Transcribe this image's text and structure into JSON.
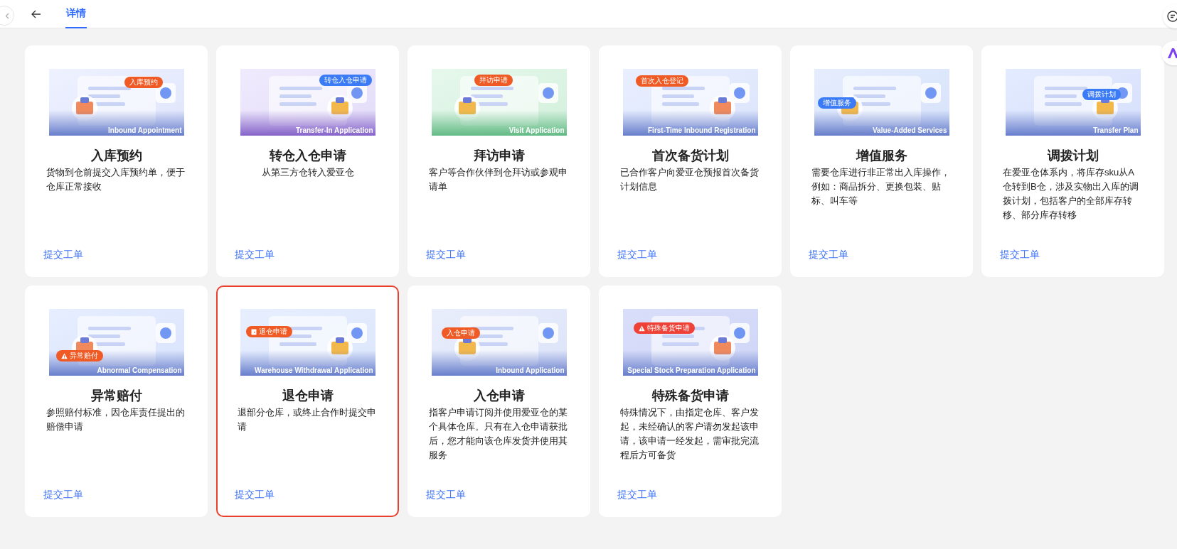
{
  "header": {
    "tabs": [
      {
        "label": "详情",
        "selected": true
      }
    ]
  },
  "cards": [
    {
      "title": "入库预约",
      "description": "货物到仓前提交入库预约单，便于仓库正常接收",
      "link": "提交工单",
      "selected": false,
      "image": {
        "badge": {
          "label": "入库预约",
          "color": "#f05a24",
          "kind": "plain"
        },
        "caption": "Inbound Appointment"
      }
    },
    {
      "title": "转仓入仓申请",
      "description": "从第三方仓转入爱亚仓",
      "link": "提交工单",
      "selected": false,
      "image": {
        "badge": {
          "label": "转仓入仓申请",
          "color": "#3b7cf6",
          "kind": "plain"
        },
        "caption": "Transfer-In Application"
      }
    },
    {
      "title": "拜访申请",
      "description": "客户等合作伙伴到仓拜访或参观申请单",
      "link": "提交工单",
      "selected": false,
      "image": {
        "badge": {
          "label": "拜访申请",
          "color": "#f05a24",
          "kind": "plain"
        },
        "caption": "Visit Application"
      }
    },
    {
      "title": "首次备货计划",
      "description": "已合作客户向爱亚仓预报首次备货计划信息",
      "link": "提交工单",
      "selected": false,
      "image": {
        "badge": {
          "label": "首次入仓登记",
          "color": "#f05a24",
          "kind": "plain"
        },
        "caption": "First-Time Inbound Registration"
      }
    },
    {
      "title": "增值服务",
      "description": "需要仓库进行非正常出入库操作，例如：商品拆分、更换包装、贴标、叫车等",
      "link": "提交工单",
      "selected": false,
      "image": {
        "badge": {
          "label": "增值服务",
          "color": "#3b7cf6",
          "kind": "plain"
        },
        "caption": "Value-Added Services"
      }
    },
    {
      "title": "调拨计划",
      "description": "在爱亚仓体系内，将库存sku从A仓转到B仓，涉及实物出入库的调拨计划，包括客户的全部库存转移、部分库存转移",
      "link": "提交工单",
      "selected": false,
      "image": {
        "badge": {
          "label": "调拨计划",
          "color": "#3b7cf6",
          "kind": "plain"
        },
        "caption": "Transfer Plan"
      }
    },
    {
      "title": "异常赔付",
      "description": "参照赔付标准，因仓库责任提出的赔偿申请",
      "link": "提交工单",
      "selected": false,
      "image": {
        "badge": {
          "label": "异常赔付",
          "color": "#f05a24",
          "kind": "warning"
        },
        "caption": "Abnormal Compensation"
      }
    },
    {
      "title": "退仓申请",
      "description": "退部分仓库，或终止合作时提交申请",
      "link": "提交工单",
      "selected": true,
      "image": {
        "badge": {
          "label": "退仓申请",
          "color": "#f05a24",
          "kind": "door"
        },
        "caption": "Warehouse Withdrawal Application"
      }
    },
    {
      "title": "入仓申请",
      "description": "指客户申请订阅并使用爱亚仓的某个具体仓库。只有在入仓申请获批后，您才能向该仓库发货并使用其服务",
      "link": "提交工单",
      "selected": false,
      "image": {
        "badge": {
          "label": "入仓申请",
          "color": "#f05a24",
          "kind": "plain"
        },
        "caption": "Inbound Application"
      }
    },
    {
      "title": "特殊备货申请",
      "description": "特殊情况下，由指定仓库、客户发起，未经确认的客户请勿发起该申请，该申请一经发起，需审批完流程后方可备货",
      "link": "提交工单",
      "selected": false,
      "image": {
        "badge": {
          "label": "特殊备货申请",
          "color": "#ef4136",
          "kind": "warning"
        },
        "caption": "Special Stock Preparation Application"
      }
    }
  ]
}
